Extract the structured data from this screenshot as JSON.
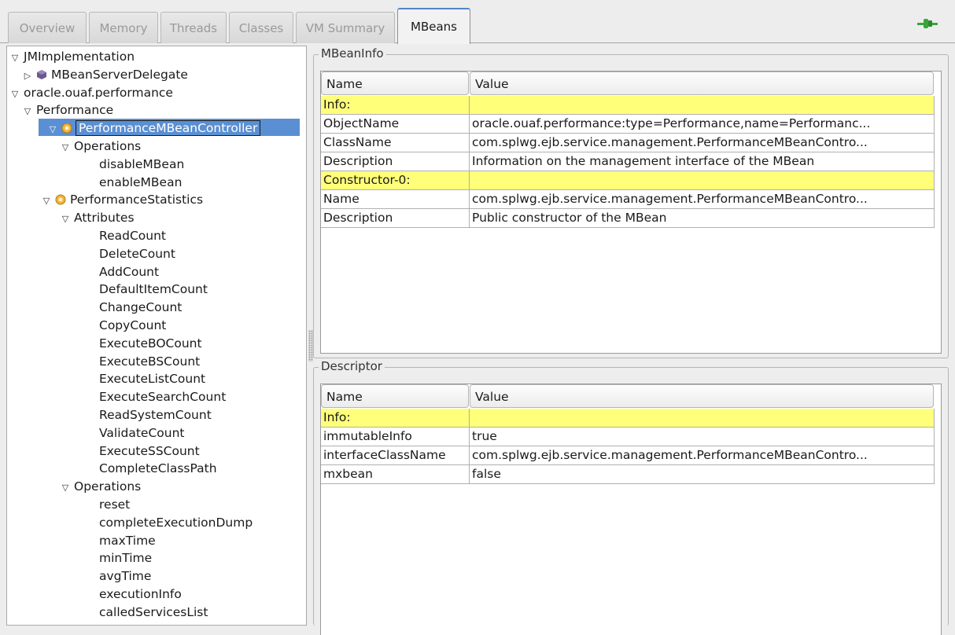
{
  "tabs": [
    {
      "label": "Overview",
      "active": false
    },
    {
      "label": "Memory",
      "active": false
    },
    {
      "label": "Threads",
      "active": false
    },
    {
      "label": "Classes",
      "active": false
    },
    {
      "label": "VM Summary",
      "active": false
    },
    {
      "label": "MBeans",
      "active": true
    }
  ],
  "tree": [
    {
      "label": "JMImplementation",
      "toggle": "expanded",
      "icon": "none",
      "selected": false
    },
    {
      "label": "MBeanServerDelegate",
      "toggle": "collapsed",
      "icon": "mbean-icon",
      "selected": false
    },
    {
      "label": "oracle.ouaf.performance",
      "toggle": "expanded",
      "icon": "none",
      "selected": false
    },
    {
      "label": "Performance",
      "toggle": "expanded",
      "icon": "none",
      "selected": false
    },
    {
      "label": "PerformanceMBeanController",
      "toggle": "expanded",
      "icon": "bean-icon",
      "selected": true
    },
    {
      "label": "Operations",
      "toggle": "expanded",
      "icon": "none",
      "selected": false
    },
    {
      "label": "disableMBean",
      "toggle": "leaf",
      "icon": "none",
      "selected": false
    },
    {
      "label": "enableMBean",
      "toggle": "leaf",
      "icon": "none",
      "selected": false
    },
    {
      "label": "PerformanceStatistics",
      "toggle": "expanded",
      "icon": "bean-icon",
      "selected": false
    },
    {
      "label": "Attributes",
      "toggle": "expanded",
      "icon": "none",
      "selected": false
    },
    {
      "label": "ReadCount",
      "toggle": "leaf",
      "icon": "none",
      "selected": false
    },
    {
      "label": "DeleteCount",
      "toggle": "leaf",
      "icon": "none",
      "selected": false
    },
    {
      "label": "AddCount",
      "toggle": "leaf",
      "icon": "none",
      "selected": false
    },
    {
      "label": "DefaultItemCount",
      "toggle": "leaf",
      "icon": "none",
      "selected": false
    },
    {
      "label": "ChangeCount",
      "toggle": "leaf",
      "icon": "none",
      "selected": false
    },
    {
      "label": "CopyCount",
      "toggle": "leaf",
      "icon": "none",
      "selected": false
    },
    {
      "label": "ExecuteBOCount",
      "toggle": "leaf",
      "icon": "none",
      "selected": false
    },
    {
      "label": "ExecuteBSCount",
      "toggle": "leaf",
      "icon": "none",
      "selected": false
    },
    {
      "label": "ExecuteListCount",
      "toggle": "leaf",
      "icon": "none",
      "selected": false
    },
    {
      "label": "ExecuteSearchCount",
      "toggle": "leaf",
      "icon": "none",
      "selected": false
    },
    {
      "label": "ReadSystemCount",
      "toggle": "leaf",
      "icon": "none",
      "selected": false
    },
    {
      "label": "ValidateCount",
      "toggle": "leaf",
      "icon": "none",
      "selected": false
    },
    {
      "label": "ExecuteSSCount",
      "toggle": "leaf",
      "icon": "none",
      "selected": false
    },
    {
      "label": "CompleteClassPath",
      "toggle": "leaf",
      "icon": "none",
      "selected": false
    },
    {
      "label": "Operations",
      "toggle": "expanded",
      "icon": "none",
      "selected": false
    },
    {
      "label": "reset",
      "toggle": "leaf",
      "icon": "none",
      "selected": false
    },
    {
      "label": "completeExecutionDump",
      "toggle": "leaf",
      "icon": "none",
      "selected": false
    },
    {
      "label": "maxTime",
      "toggle": "leaf",
      "icon": "none",
      "selected": false
    },
    {
      "label": "minTime",
      "toggle": "leaf",
      "icon": "none",
      "selected": false
    },
    {
      "label": "avgTime",
      "toggle": "leaf",
      "icon": "none",
      "selected": false
    },
    {
      "label": "executionInfo",
      "toggle": "leaf",
      "icon": "none",
      "selected": false
    },
    {
      "label": "calledServicesList",
      "toggle": "leaf",
      "icon": "none",
      "selected": false
    }
  ],
  "mbeaninfo": {
    "title": "MBeanInfo",
    "headers": [
      "Name",
      "Value"
    ],
    "rows": [
      {
        "name": "Info:",
        "value": "",
        "highlight": true
      },
      {
        "name": "ObjectName",
        "value": "oracle.ouaf.performance:type=Performance,name=Performanc...",
        "highlight": false
      },
      {
        "name": "ClassName",
        "value": "com.splwg.ejb.service.management.PerformanceMBeanContro...",
        "highlight": false
      },
      {
        "name": "Description",
        "value": "Information on the management interface of the MBean",
        "highlight": false
      },
      {
        "name": "Constructor-0:",
        "value": "",
        "highlight": true
      },
      {
        "name": "Name",
        "value": "com.splwg.ejb.service.management.PerformanceMBeanContro...",
        "highlight": false
      },
      {
        "name": "Description",
        "value": "Public constructor of the MBean",
        "highlight": false
      }
    ]
  },
  "descriptor": {
    "title": "Descriptor",
    "headers": [
      "Name",
      "Value"
    ],
    "rows": [
      {
        "name": "Info:",
        "value": "",
        "highlight": true
      },
      {
        "name": "immutableInfo",
        "value": "true",
        "highlight": false
      },
      {
        "name": "interfaceClassName",
        "value": "com.splwg.ejb.service.management.PerformanceMBeanContro...",
        "highlight": false
      },
      {
        "name": "mxbean",
        "value": "false",
        "highlight": false
      }
    ]
  },
  "colors": {
    "selection": "#5b8fd3",
    "highlight_row": "#ffff7a",
    "active_tab_accent": "#4f86c9",
    "connect_icon": "#3aa53a"
  }
}
